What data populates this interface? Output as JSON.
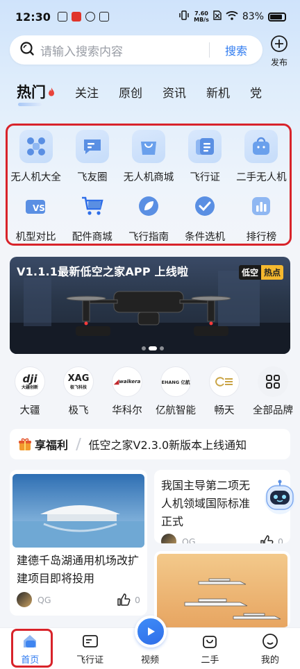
{
  "status_bar": {
    "time": "12:30",
    "net_speed_value": "7.60",
    "net_speed_unit": "MB/s",
    "battery": "83%"
  },
  "search": {
    "placeholder": "请输入搜索内容",
    "button": "搜索",
    "publish_label": "发布"
  },
  "tabs": [
    "热门",
    "关注",
    "原创",
    "资讯",
    "新机",
    "党"
  ],
  "quick_menu": [
    {
      "label": "无人机大全",
      "icon": "drone-icon"
    },
    {
      "label": "飞友圈",
      "icon": "chat-bubble-icon"
    },
    {
      "label": "无人机商城",
      "icon": "shopping-bag-icon"
    },
    {
      "label": "飞行证",
      "icon": "certificate-icon"
    },
    {
      "label": "二手无人机",
      "icon": "secondhand-bag-icon"
    },
    {
      "label": "机型对比",
      "icon": "vs-compare-icon"
    },
    {
      "label": "配件商城",
      "icon": "cart-icon"
    },
    {
      "label": "飞行指南",
      "icon": "leaf-guide-icon"
    },
    {
      "label": "条件选机",
      "icon": "check-circle-icon"
    },
    {
      "label": "排行榜",
      "icon": "bar-chart-icon"
    }
  ],
  "banner": {
    "title": "V1.1.1最新低空之家APP 上线啦",
    "tag_left": "低空",
    "tag_right": "热点"
  },
  "brands": [
    {
      "label": "大疆",
      "logo_text": "dji",
      "logo_sub": "大疆创新"
    },
    {
      "label": "极飞",
      "logo_text": "XAG",
      "logo_sub": "极飞科技"
    },
    {
      "label": "华科尔",
      "logo_text": "walkera"
    },
    {
      "label": "亿航智能",
      "logo_text": "EHANG 亿航"
    },
    {
      "label": "畅天"
    },
    {
      "label": "全部品牌"
    }
  ],
  "notice": {
    "tag": "享福利",
    "text": "低空之家V2.3.0新版本上线通知"
  },
  "feed": [
    {
      "title": "建德千岛湖通用机场改扩建项目即将投用",
      "author": "QG",
      "likes": "0"
    },
    {
      "title": "我国主导第二项无人机领域国际标准正式",
      "author": "QG",
      "likes": "0"
    }
  ],
  "tabbar": [
    {
      "label": "首页",
      "icon": "home-icon"
    },
    {
      "label": "飞行证",
      "icon": "license-card-icon"
    },
    {
      "label": "视频",
      "icon": "play-icon"
    },
    {
      "label": "二手",
      "icon": "bag-icon"
    },
    {
      "label": "我的",
      "icon": "smiley-icon"
    }
  ],
  "colors": {
    "accent": "#2f7bf0",
    "highlight_border": "#d8232a"
  }
}
